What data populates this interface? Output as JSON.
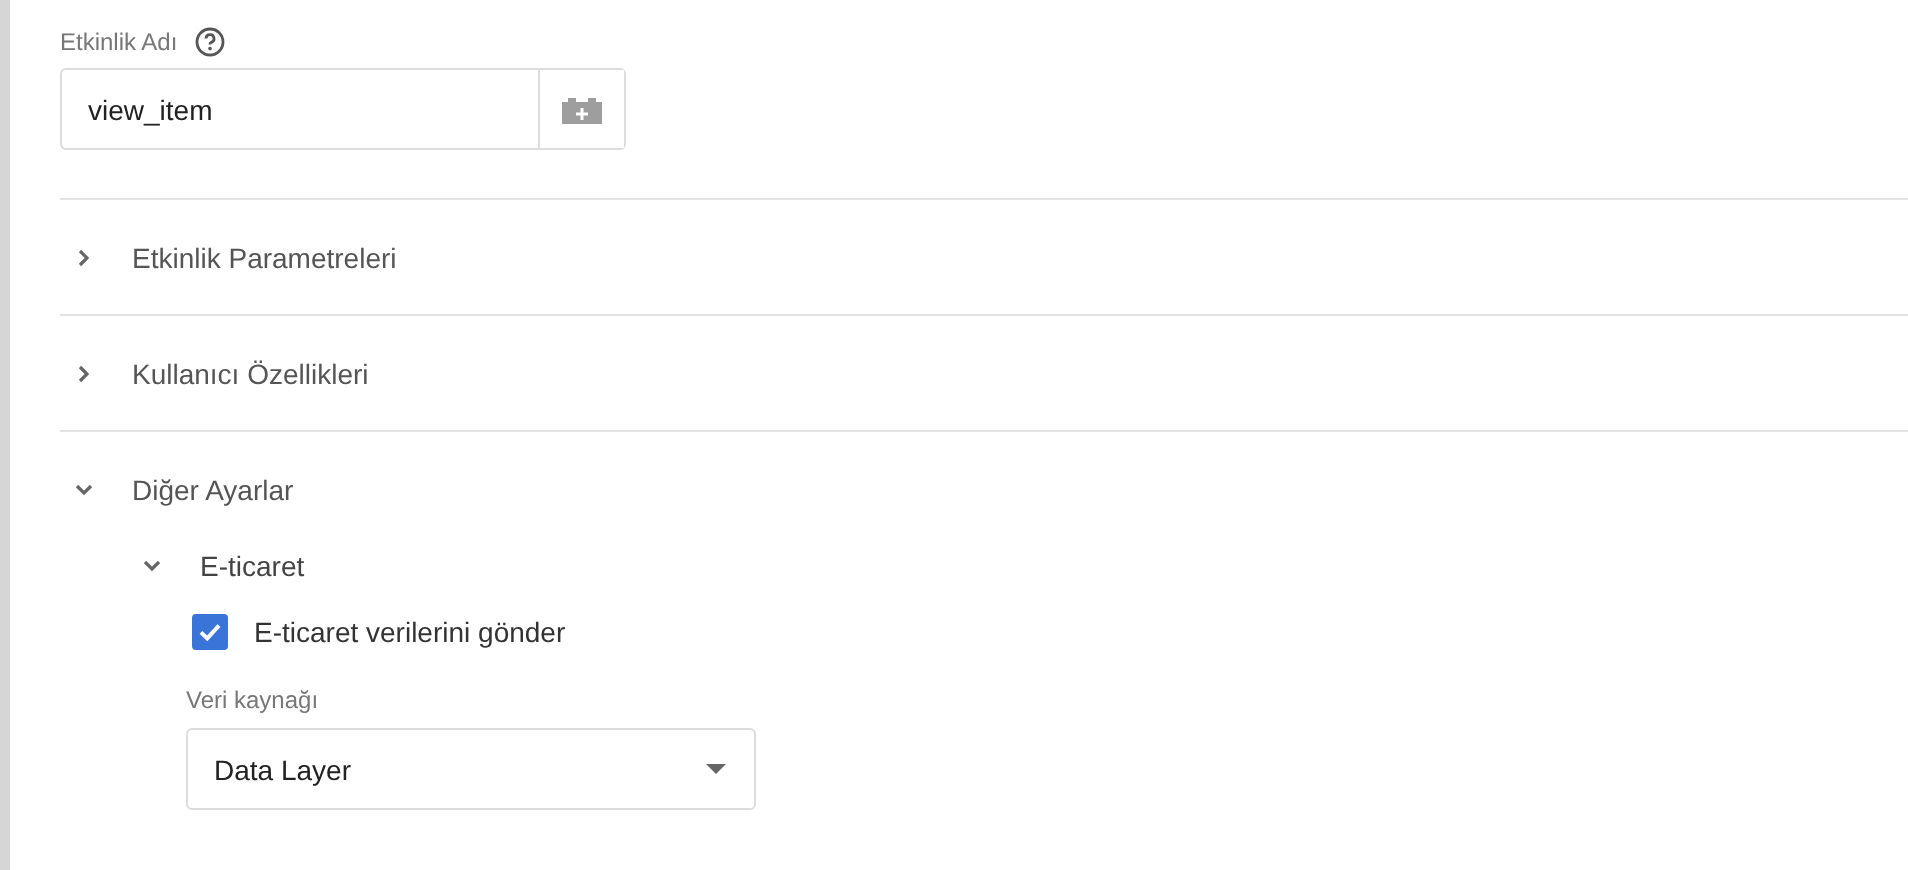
{
  "event_name": {
    "label": "Etkinlik Adı",
    "value": "view_item"
  },
  "sections": [
    {
      "title": "Etkinlik Parametreleri",
      "expanded": false
    },
    {
      "title": "Kullanıcı Özellikleri",
      "expanded": false
    },
    {
      "title": "Diğer Ayarlar",
      "expanded": true,
      "children": [
        {
          "title": "E-ticaret",
          "expanded": true,
          "checkbox": {
            "label": "E-ticaret verilerini gönder",
            "checked": true
          },
          "select": {
            "label": "Veri kaynağı",
            "value": "Data Layer"
          }
        }
      ]
    }
  ]
}
